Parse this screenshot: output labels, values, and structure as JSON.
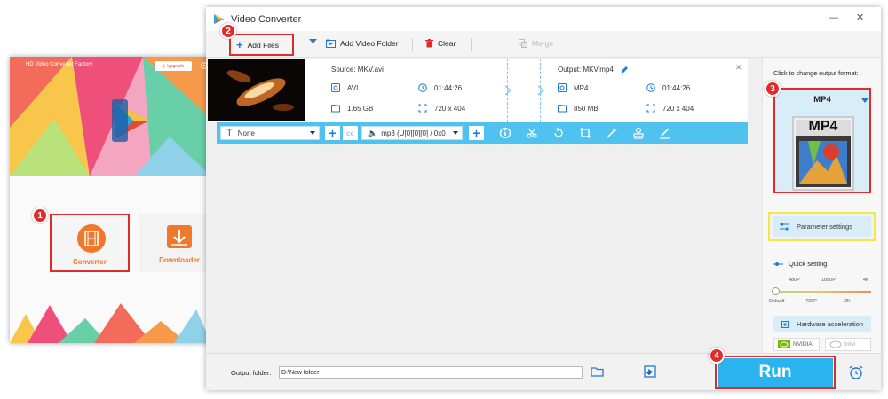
{
  "launcher": {
    "title": "HD Video Converter Factory",
    "upgrade_label": "Upgrade",
    "converter_label": "Converter",
    "downloader_label": "Downloader"
  },
  "window": {
    "title": "Video Converter",
    "minimize_glyph": "—",
    "close_glyph": "✕"
  },
  "toolbar": {
    "add_files": "Add Files",
    "add_video_folder": "Add Video Folder",
    "clear": "Clear",
    "merge": "Merge"
  },
  "file": {
    "source_label": "Source: MKV.avi",
    "output_label": "Output: MKV.mp4",
    "source": {
      "format": "AVI",
      "duration": "01:44:26",
      "size": "1.65 GB",
      "resolution": "720 x 404"
    },
    "output": {
      "format": "MP4",
      "duration": "01:44:26",
      "size": "850 MB",
      "resolution": "720 x 404"
    },
    "close_glyph": "✕"
  },
  "edit_bar": {
    "subtitle_value": "None",
    "audio_value": "mp3 (U[0][0][0] / 0x0"
  },
  "right_panel": {
    "click_text": "Click to change output format:",
    "format_name": "MP4",
    "format_icon_text": "MP4",
    "parameter_settings": "Parameter settings",
    "quick_setting": "Quick setting",
    "quick_top_labels": [
      "480P",
      "1080P",
      "4K"
    ],
    "quick_bottom_labels": [
      "Default",
      "720P",
      "2K"
    ],
    "quick_level": 0,
    "hardware_acceleration": "Hardware acceleration",
    "nvidia": "NVIDIA",
    "intel": "Intel"
  },
  "bottom_bar": {
    "output_folder_label": "Output folder:",
    "output_folder_value": "D:\\New folder",
    "run_label": "Run"
  },
  "steps": [
    "1",
    "2",
    "3",
    "4"
  ],
  "colors": {
    "accent_blue": "#50c2f0",
    "run_blue": "#29b3ef",
    "highlight_red": "#e02b2b",
    "highlight_yellow": "#f2e64b",
    "converter_orange": "#f0782a"
  }
}
